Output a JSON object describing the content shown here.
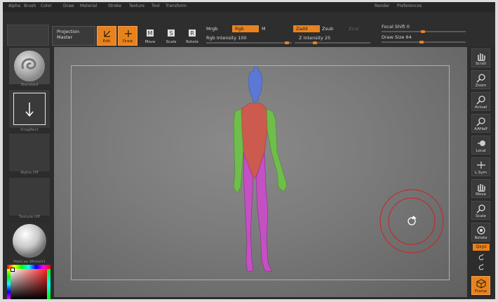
{
  "menu": [
    "Alpha",
    "Brush",
    "Color",
    "Draw",
    "Material",
    "Stroke",
    "Texture",
    "Tool",
    "Transform",
    "Render",
    "Preferences"
  ],
  "toolbar": {
    "projection_master": [
      "Projection",
      "Master"
    ],
    "edit": "Edit",
    "draw": "Draw",
    "move": "Move",
    "scale": "Scale",
    "rotate": "Rotate",
    "mrgb": "Mrgb",
    "rgb": "Rgb",
    "m": "M",
    "rgb_intensity": "Rgb Intensity 100",
    "zadd": "Zadd",
    "zsub": "Zsub",
    "zcut": "Zcut",
    "z_intensity": "Z Intensity 25",
    "focal_shift": "Focal Shift 0",
    "draw_size": "Draw Size 64"
  },
  "left_shelf": {
    "standard": "Standard",
    "dragrect": "DragRect",
    "alpha_off": "Alpha Off",
    "texture_off": "Texture Off",
    "material": "MatCap White01"
  },
  "right_shelf": [
    "Scroll",
    "Zoom",
    "Actual",
    "AAHalf",
    "Local",
    "L.Sym",
    "Move",
    "Scale",
    "Rotate",
    "Frame"
  ],
  "polyf_label": "Qxyz",
  "colors": {
    "accent": "#e8821e",
    "head": "#5b78d4",
    "torso": "#cc5a4e",
    "arms": "#6fbd4a",
    "legs": "#c450c4"
  }
}
